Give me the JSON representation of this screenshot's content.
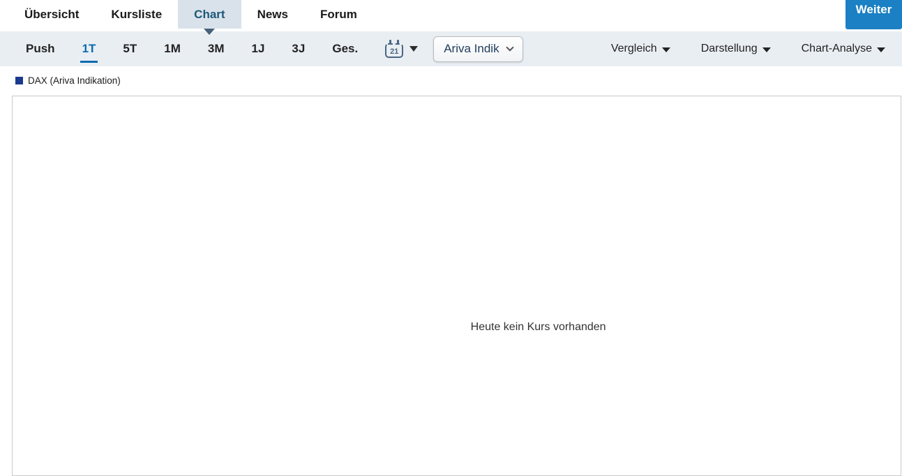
{
  "nav": {
    "items": [
      {
        "label": "Übersicht"
      },
      {
        "label": "Kursliste"
      },
      {
        "label": "Chart"
      },
      {
        "label": "News"
      },
      {
        "label": "Forum"
      }
    ],
    "active_item": "Chart",
    "weiter_label": "Weiter"
  },
  "toolbar": {
    "ranges": [
      {
        "label": "Push"
      },
      {
        "label": "1T"
      },
      {
        "label": "5T"
      },
      {
        "label": "1M"
      },
      {
        "label": "3M"
      },
      {
        "label": "1J"
      },
      {
        "label": "3J"
      },
      {
        "label": "Ges."
      }
    ],
    "active_range": "1T",
    "calendar_day": "21",
    "indicator_dropdown": "Ariva Indik",
    "menus": [
      {
        "label": "Vergleich"
      },
      {
        "label": "Darstellung"
      },
      {
        "label": "Chart-Analyse"
      }
    ]
  },
  "legend": {
    "series_label": "DAX (Ariva Indikation)"
  },
  "chart": {
    "empty_message": "Heute kein Kurs vorhanden"
  },
  "colors": {
    "accent_blue": "#0a6bb0",
    "active_tab_bg": "#d9e2ea",
    "toolbar_bg": "#e9eef3",
    "weiter_bg": "#1b80c4",
    "series_navy": "#1b3a8f"
  }
}
